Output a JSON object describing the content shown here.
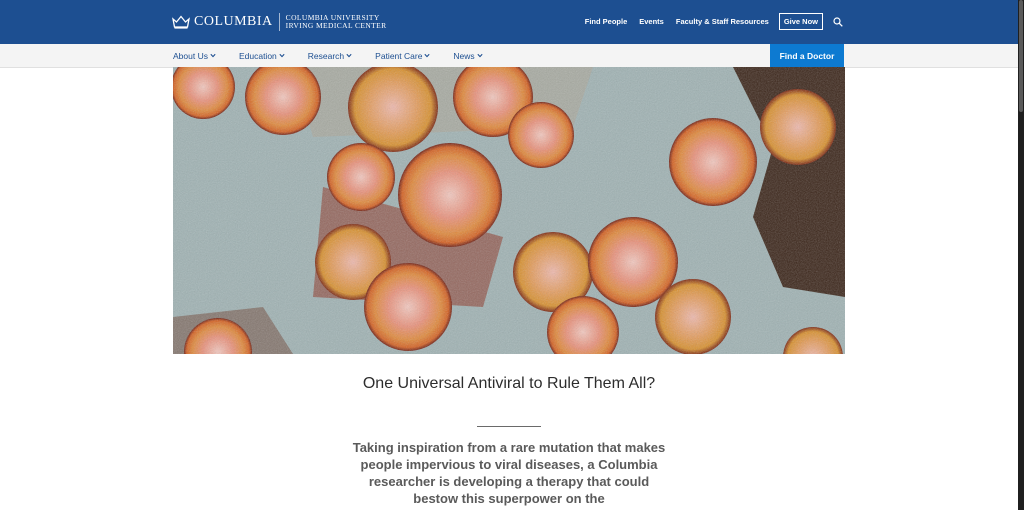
{
  "header": {
    "brand": "COLUMBIA",
    "sub_line1": "Columbia University",
    "sub_line2": "Irving Medical Center",
    "links": [
      "Find People",
      "Events",
      "Faculty & Staff Resources"
    ],
    "give_label": "Give Now",
    "search_icon": "search-icon"
  },
  "nav": {
    "items": [
      {
        "label": "About Us"
      },
      {
        "label": "Education"
      },
      {
        "label": "Research"
      },
      {
        "label": "Patient Care"
      },
      {
        "label": "News"
      }
    ],
    "cta_label": "Find a Doctor"
  },
  "article": {
    "title": "One Universal Antiviral to Rule Them All?",
    "dek": "Taking inspiration from a rare mutation that makes people impervious to viral diseases, a Columbia researcher is developing a therapy that could bestow this superpower on the"
  },
  "colors": {
    "brand_blue": "#1d4f91",
    "cta_blue": "#0d7ad1"
  }
}
